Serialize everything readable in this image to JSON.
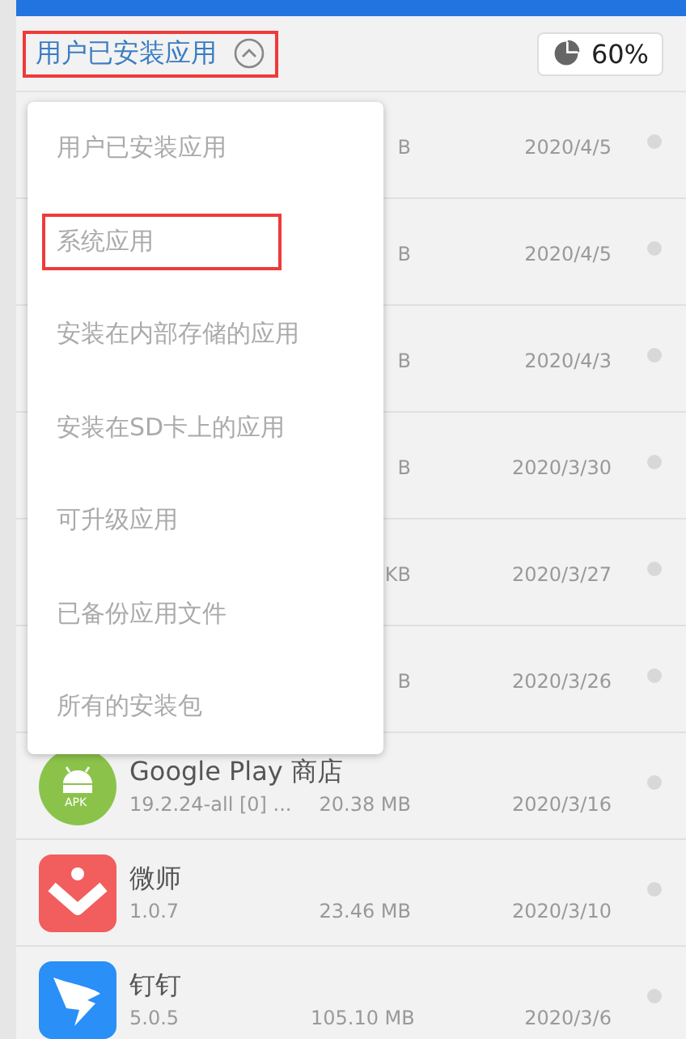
{
  "header": {
    "filter": {
      "label": "用户已安装应用",
      "highlighted": true,
      "expanded": true
    },
    "storage": {
      "label": "60%"
    }
  },
  "apps": [
    {
      "size": "B",
      "date": "2020/4/5"
    },
    {
      "size": "B",
      "date": "2020/4/5"
    },
    {
      "size": "B",
      "date": "2020/4/3"
    },
    {
      "size": "B",
      "date": "2020/3/30"
    },
    {
      "size": "KB",
      "date": "2020/3/27"
    },
    {
      "size": "B",
      "date": "2020/3/26"
    },
    {
      "kind": "apk",
      "icon_label": "APK",
      "name": "Google Play 商店",
      "version": "19.2.24-all [0] ...",
      "size": "20.38 MB",
      "date": "2020/3/16"
    },
    {
      "kind": "weishi",
      "name": "微师",
      "version": "1.0.7",
      "size": "23.46 MB",
      "date": "2020/3/10"
    },
    {
      "kind": "dingtalk",
      "name": "钉钉",
      "version": "5.0.5",
      "size": "105.10 MB",
      "date": "2020/3/6"
    }
  ],
  "menu": {
    "items": [
      {
        "label": "用户已安装应用",
        "highlighted": false
      },
      {
        "label": "系统应用",
        "highlighted": true
      },
      {
        "label": "安装在内部存储的应用",
        "highlighted": false
      },
      {
        "label": "安装在SD卡上的应用",
        "highlighted": false
      },
      {
        "label": "可升级应用",
        "highlighted": false
      },
      {
        "label": "已备份应用文件",
        "highlighted": false
      },
      {
        "label": "所有的安装包",
        "highlighted": false
      }
    ]
  }
}
